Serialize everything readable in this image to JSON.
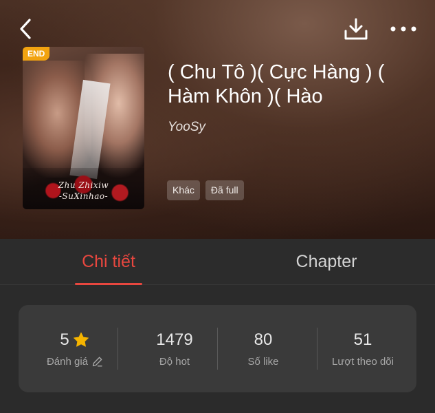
{
  "header": {
    "back_icon": "chevron-left-icon",
    "download_icon": "download-icon",
    "more_icon": "more-horizontal-icon"
  },
  "book": {
    "status_badge": "END",
    "title": "( Chu Tô )( Cực Hàng ) ( Hàm Khôn )( Hào",
    "author": "YooSy",
    "cover_text_line1": "Zhu Zhixiw",
    "cover_text_line2": "-SuXinhao-",
    "tags": [
      "Khác",
      "Đã full"
    ]
  },
  "tabs": {
    "detail": "Chi tiết",
    "chapter": "Chapter",
    "active": "detail"
  },
  "stats": {
    "rating": {
      "value": "5",
      "label": "Đánh giá",
      "icon": "star-icon",
      "edit_icon": "pencil-icon"
    },
    "hot": {
      "value": "1479",
      "label": "Độ hot"
    },
    "likes": {
      "value": "80",
      "label": "Số like"
    },
    "followers": {
      "value": "51",
      "label": "Lượt theo dõi"
    }
  },
  "colors": {
    "accent": "#e8473f",
    "badge": "#f2a310",
    "star": "#f5b400"
  }
}
